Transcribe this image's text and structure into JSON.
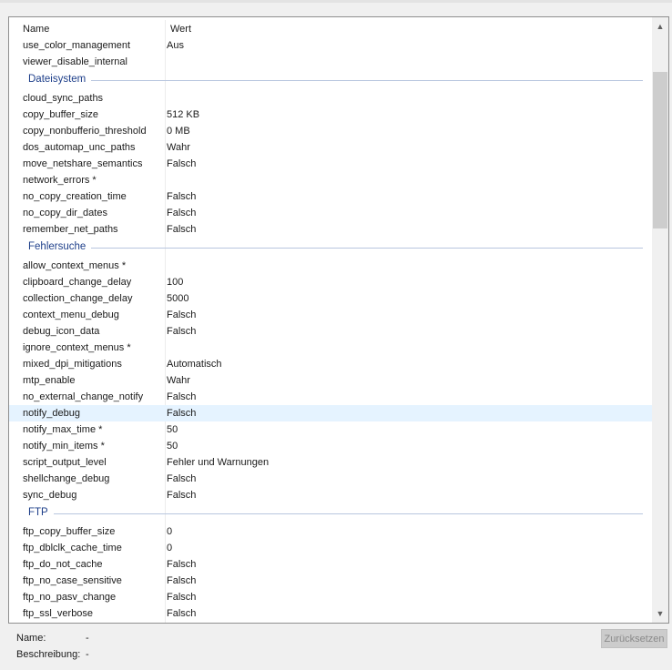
{
  "table": {
    "columns": {
      "name": "Name",
      "value": "Wert"
    },
    "pre_rows": [
      {
        "name": "use_color_management",
        "value": "Aus"
      },
      {
        "name": "viewer_disable_internal",
        "value": ""
      }
    ],
    "groups": [
      {
        "title": "Dateisystem",
        "rows": [
          {
            "name": "cloud_sync_paths",
            "value": ""
          },
          {
            "name": "copy_buffer_size",
            "value": "512 KB"
          },
          {
            "name": "copy_nonbufferio_threshold",
            "value": "0 MB"
          },
          {
            "name": "dos_automap_unc_paths",
            "value": "Wahr"
          },
          {
            "name": "move_netshare_semantics",
            "value": "Falsch"
          },
          {
            "name": "network_errors *",
            "value": ""
          },
          {
            "name": "no_copy_creation_time",
            "value": "Falsch"
          },
          {
            "name": "no_copy_dir_dates",
            "value": "Falsch"
          },
          {
            "name": "remember_net_paths",
            "value": "Falsch"
          }
        ]
      },
      {
        "title": "Fehlersuche",
        "rows": [
          {
            "name": "allow_context_menus *",
            "value": ""
          },
          {
            "name": "clipboard_change_delay",
            "value": "100"
          },
          {
            "name": "collection_change_delay",
            "value": "5000"
          },
          {
            "name": "context_menu_debug",
            "value": "Falsch"
          },
          {
            "name": "debug_icon_data",
            "value": "Falsch"
          },
          {
            "name": "ignore_context_menus *",
            "value": ""
          },
          {
            "name": "mixed_dpi_mitigations",
            "value": "Automatisch"
          },
          {
            "name": "mtp_enable",
            "value": "Wahr"
          },
          {
            "name": "no_external_change_notify",
            "value": "Falsch"
          },
          {
            "name": "notify_debug",
            "value": "Falsch",
            "selected": true
          },
          {
            "name": "notify_max_time *",
            "value": "50"
          },
          {
            "name": "notify_min_items *",
            "value": "50"
          },
          {
            "name": "script_output_level",
            "value": "Fehler und Warnungen"
          },
          {
            "name": "shellchange_debug",
            "value": "Falsch"
          },
          {
            "name": "sync_debug",
            "value": "Falsch"
          }
        ]
      },
      {
        "title": "FTP",
        "rows": [
          {
            "name": "ftp_copy_buffer_size",
            "value": "0"
          },
          {
            "name": "ftp_dblclk_cache_time",
            "value": "0"
          },
          {
            "name": "ftp_do_not_cache",
            "value": "Falsch"
          },
          {
            "name": "ftp_no_case_sensitive",
            "value": "Falsch"
          },
          {
            "name": "ftp_no_pasv_change",
            "value": "Falsch"
          },
          {
            "name": "ftp_ssl_verbose",
            "value": "Falsch"
          }
        ]
      }
    ]
  },
  "footer": {
    "name_label": "Name:",
    "name_value": "-",
    "description_label": "Beschreibung:",
    "description_value": "-",
    "reset_label": "Zurücksetzen"
  },
  "icons": {
    "scroll_up": "chevron-up-icon",
    "scroll_down": "chevron-down-icon"
  }
}
